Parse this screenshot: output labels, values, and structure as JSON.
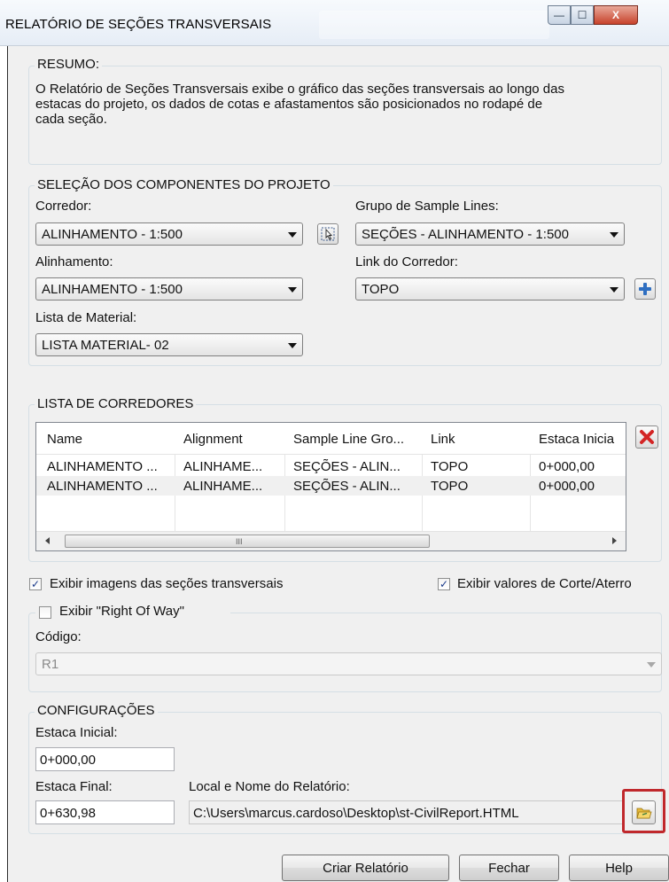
{
  "window": {
    "title": "RELATÓRIO DE SEÇÕES TRANSVERSAIS",
    "minimize_glyph": "—",
    "maximize_glyph": "☐",
    "close_glyph": "X"
  },
  "summary": {
    "legend": "RESUMO:",
    "text_line1": "O Relatório de Seções Transversais exibe o gráfico das seções transversais ao longo das",
    "text_line2": "estacas do projeto, os dados de cotas e afastamentos são posicionados no rodapé de",
    "text_line3": "cada seção."
  },
  "components": {
    "legend": "SELEÇÃO DOS COMPONENTES DO PROJETO",
    "corredor_label": "Corredor:",
    "corredor_value": "ALINHAMENTO - 1:500",
    "sample_group_label": "Grupo de Sample Lines:",
    "sample_group_value": "SEÇÕES - ALINHAMENTO - 1:500",
    "alinhamento_label": "Alinhamento:",
    "alinhamento_value": "ALINHAMENTO - 1:500",
    "link_label": "Link do Corredor:",
    "link_value": "TOPO",
    "material_label": "Lista de Material:",
    "material_value": "LISTA MATERIAL- 02"
  },
  "corridors": {
    "legend": "LISTA DE CORREDORES",
    "columns": [
      "Name",
      "Alignment",
      "Sample Line Gro...",
      "Link",
      "Estaca Inicia"
    ],
    "rows": [
      [
        "ALINHAMENTO ...",
        "ALINHAME...",
        "SEÇÕES - ALIN...",
        "TOPO",
        "0+000,00"
      ],
      [
        "ALINHAMENTO ...",
        "ALINHAME...",
        "SEÇÕES - ALIN...",
        "TOPO",
        "0+000,00"
      ]
    ],
    "scroll_grip": "III"
  },
  "options": {
    "show_images_label": "Exibir imagens das seções transversais",
    "show_images_checked": true,
    "show_cut_fill_label": "Exibir valores de Corte/Aterro",
    "show_cut_fill_checked": true,
    "show_row_label": "Exibir \"Right Of Way\"",
    "show_row_checked": false,
    "code_label": "Código:",
    "code_value": "R1"
  },
  "config": {
    "legend": "CONFIGURAÇÕES",
    "start_label": "Estaca Inicial:",
    "start_value": "0+000,00",
    "end_label": "Estaca Final:",
    "end_value": "0+630,98",
    "path_label": "Local e Nome do Relatório:",
    "path_value": "C:\\Users\\marcus.cardoso\\Desktop\\st-CivilReport.HTML"
  },
  "buttons": {
    "create": "Criar Relatório",
    "close": "Fechar",
    "help": "Help"
  },
  "colors": {
    "highlight_border": "#c0282c",
    "delete_red": "#d32525",
    "add_blue": "#2f6fc1"
  }
}
